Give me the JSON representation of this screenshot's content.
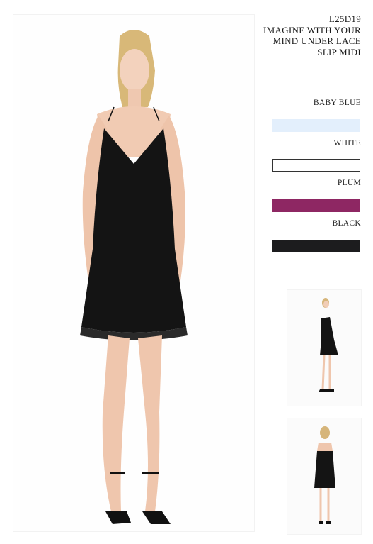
{
  "product": {
    "code": "L25D19",
    "title_lines": [
      "IMAGINE WITH YOUR",
      "MIND UNDER LACE",
      "SLIP MIDI"
    ]
  },
  "colors": [
    {
      "label": "BABY BLUE",
      "hex": "#e3effc"
    },
    {
      "label": "WHITE",
      "hex": "#ffffff"
    },
    {
      "label": "PLUM",
      "hex": "#8e2763"
    },
    {
      "label": "BLACK",
      "hex": "#1c1c1e"
    }
  ],
  "images": {
    "main": "model-front-black-dress",
    "thumbnails": [
      "model-side-black-dress",
      "model-back-black-dress"
    ]
  }
}
